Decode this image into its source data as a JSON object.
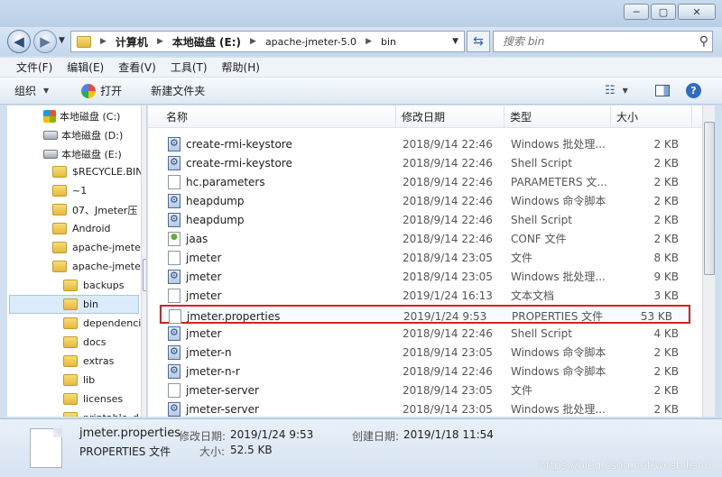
{
  "address": {
    "crumbs": [
      "计算机",
      "本地磁盘 (E:)",
      "apache-jmeter-5.0",
      "bin"
    ],
    "search_placeholder": "搜索 bin"
  },
  "menu": [
    "文件(F)",
    "编辑(E)",
    "查看(V)",
    "工具(T)",
    "帮助(H)"
  ],
  "toolbar": {
    "organize": "组织",
    "open": "打开",
    "new_folder": "新建文件夹"
  },
  "nav": {
    "drive_c": "本地磁盘 (C:)",
    "drive_d": "本地磁盘 (D:)",
    "drive_e": "本地磁盘 (E:)",
    "folders": [
      "$RECYCLE.BIN",
      "~1",
      "07、Jmeter压",
      "Android",
      "apache-jmete",
      "apache-jmete"
    ],
    "subfolders": [
      "backups",
      "bin",
      "dependenci",
      "docs",
      "extras",
      "lib",
      "licenses",
      "printable_d"
    ]
  },
  "columns": {
    "name": "名称",
    "date": "修改日期",
    "type": "类型",
    "size": "大小"
  },
  "files": [
    {
      "name": "create-rmi-keystore",
      "date": "2018/9/14 22:46",
      "type": "Windows 批处理...",
      "size": "2 KB",
      "icon": "script"
    },
    {
      "name": "create-rmi-keystore",
      "date": "2018/9/14 22:46",
      "type": "Shell Script",
      "size": "2 KB",
      "icon": "script"
    },
    {
      "name": "hc.parameters",
      "date": "2018/9/14 22:46",
      "type": "PARAMETERS 文...",
      "size": "2 KB",
      "icon": "file"
    },
    {
      "name": "heapdump",
      "date": "2018/9/14 22:46",
      "type": "Windows 命令脚本",
      "size": "2 KB",
      "icon": "script"
    },
    {
      "name": "heapdump",
      "date": "2018/9/14 22:46",
      "type": "Shell Script",
      "size": "2 KB",
      "icon": "script"
    },
    {
      "name": "jaas",
      "date": "2018/9/14 22:46",
      "type": "CONF 文件",
      "size": "2 KB",
      "icon": "conf"
    },
    {
      "name": "jmeter",
      "date": "2018/9/14 23:05",
      "type": "文件",
      "size": "8 KB",
      "icon": "file"
    },
    {
      "name": "jmeter",
      "date": "2018/9/14 23:05",
      "type": "Windows 批处理...",
      "size": "9 KB",
      "icon": "script"
    },
    {
      "name": "jmeter",
      "date": "2019/1/24 16:13",
      "type": "文本文档",
      "size": "3 KB",
      "icon": "file"
    },
    {
      "name": "jmeter.properties",
      "date": "2019/1/24 9:53",
      "type": "PROPERTIES 文件",
      "size": "53 KB",
      "icon": "file"
    },
    {
      "name": "jmeter",
      "date": "2018/9/14 22:46",
      "type": "Shell Script",
      "size": "4 KB",
      "icon": "script"
    },
    {
      "name": "jmeter-n",
      "date": "2018/9/14 23:05",
      "type": "Windows 命令脚本",
      "size": "2 KB",
      "icon": "script"
    },
    {
      "name": "jmeter-n-r",
      "date": "2018/9/14 22:46",
      "type": "Windows 命令脚本",
      "size": "2 KB",
      "icon": "script"
    },
    {
      "name": "jmeter-server",
      "date": "2018/9/14 23:05",
      "type": "文件",
      "size": "2 KB",
      "icon": "file"
    },
    {
      "name": "jmeter-server",
      "date": "2018/9/14 23:05",
      "type": "Windows 批处理...",
      "size": "2 KB",
      "icon": "script"
    }
  ],
  "details": {
    "filename": "jmeter.properties",
    "filetype": "PROPERTIES 文件",
    "modified_label": "修改日期:",
    "modified_value": "2019/1/24 9:53",
    "created_label": "创建日期:",
    "created_value": "2019/1/18 11:54",
    "size_label": "大小:",
    "size_value": "52.5 KB"
  },
  "watermark": "https://blog.csdn.net/woshilishu"
}
